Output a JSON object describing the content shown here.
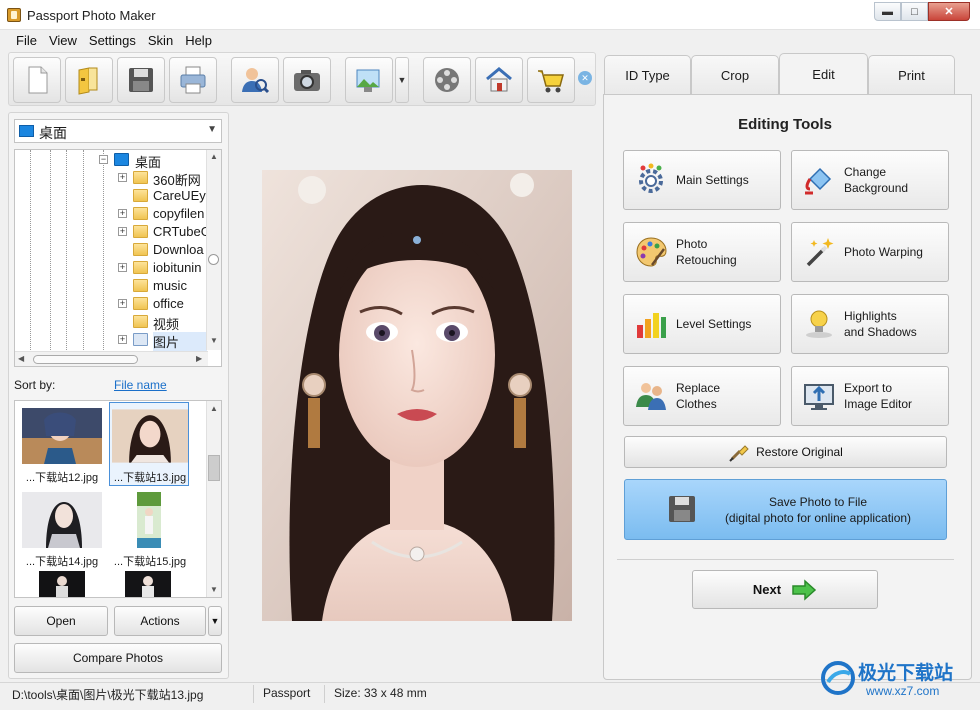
{
  "window": {
    "title": "Passport Photo Maker"
  },
  "menu": [
    "File",
    "View",
    "Settings",
    "Skin",
    "Help"
  ],
  "toolbar": {
    "icons": [
      "new-document-icon",
      "open-folder-icon",
      "save-floppy-icon",
      "print-icon",
      "find-person-icon",
      "camera-icon",
      "image-enhance-icon",
      "video-reel-icon",
      "home-icon",
      "shopping-cart-icon"
    ]
  },
  "folder": {
    "selected": "桌面"
  },
  "tree": {
    "root": "桌面",
    "items": [
      "360断网",
      "CareUEye",
      "copyfilen",
      "CRTubeG",
      "Downloa",
      "iobitunin",
      "music",
      "office",
      "视频",
      "图片"
    ]
  },
  "sort": {
    "label": "Sort by:",
    "value": "File name"
  },
  "thumbnails": [
    {
      "caption": "...下载站12.jpg"
    },
    {
      "caption": "...下载站13.jpg"
    },
    {
      "caption": "...下载站14.jpg"
    },
    {
      "caption": "...下载站15.jpg"
    }
  ],
  "buttons": {
    "open": "Open",
    "actions": "Actions",
    "compare": "Compare Photos",
    "restore": "Restore Original",
    "save_line1": "Save Photo to File",
    "save_line2": "(digital photo for online application)",
    "next": "Next"
  },
  "tabs": [
    "ID Type",
    "Crop",
    "Edit",
    "Print"
  ],
  "active_tab": "Edit",
  "editing_tools": {
    "title": "Editing Tools",
    "tools": [
      "Main Settings",
      "Change\nBackground",
      "Photo\nRetouching",
      "Photo Warping",
      "Level Settings",
      "Highlights\nand Shadows",
      "Replace\nClothes",
      "Export to\nImage Editor"
    ]
  },
  "status": {
    "path": "D:\\tools\\桌面\\图片\\极光下载站13.jpg",
    "mode": "Passport",
    "size": "Size: 33 x 48 mm"
  },
  "watermark": {
    "text": "极光下载站",
    "url": "www.xz7.com"
  }
}
